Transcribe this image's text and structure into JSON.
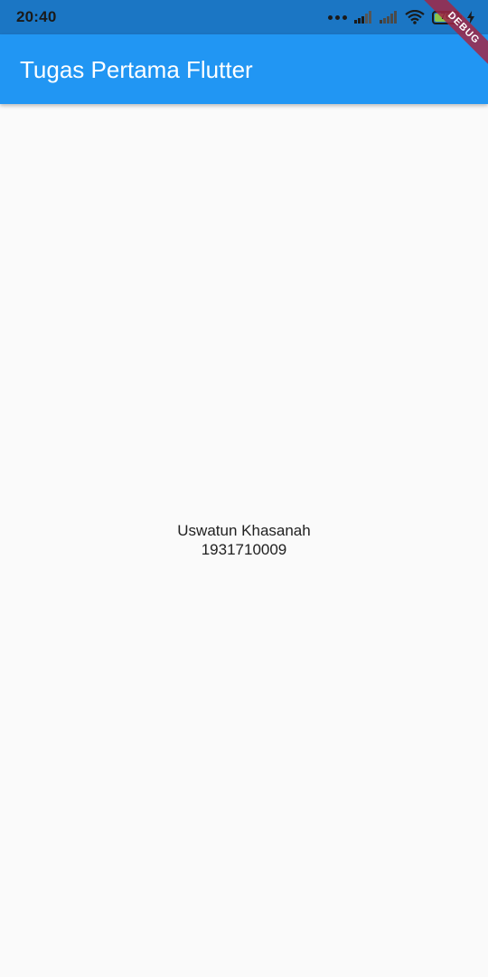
{
  "status_bar": {
    "time": "20:40",
    "battery_level": "76",
    "colors": {
      "background": "#1b76c4"
    },
    "icons": [
      "more-dots-icon",
      "signal-icon",
      "signal-weak-icon",
      "wifi-icon",
      "battery-icon",
      "charging-bolt-icon"
    ]
  },
  "app_bar": {
    "title": "Tugas Pertama Flutter",
    "colors": {
      "background": "#2196f3",
      "text": "#ffffff"
    }
  },
  "debug_banner": {
    "label": "DEBUG"
  },
  "content": {
    "name": "Uswatun Khasanah",
    "id_number": "1931710009"
  },
  "colors": {
    "page_background": "#fafafa",
    "body_text": "#212121"
  }
}
